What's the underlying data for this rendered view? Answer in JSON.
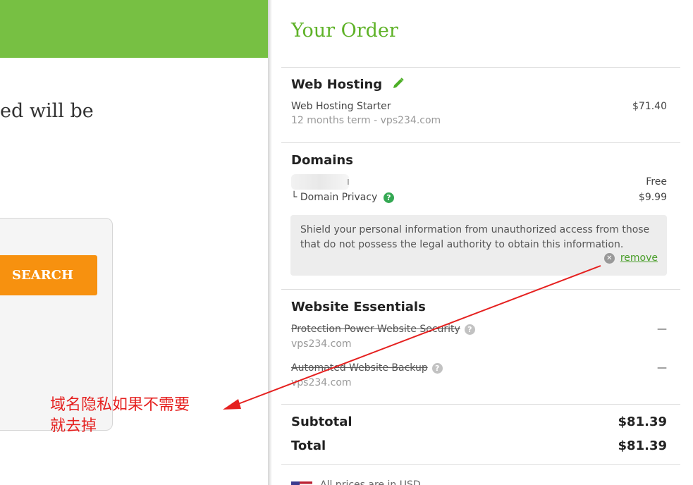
{
  "left": {
    "intro_text": "ed will be",
    "search_button": "SEARCH",
    "annotation_line1": "域名隐私如果不需要",
    "annotation_line2": "就去掉"
  },
  "order": {
    "title": "Your Order",
    "hosting": {
      "title": "Web Hosting",
      "product": "Web Hosting Starter",
      "term": "12 months term - vps234.com",
      "price": "$71.40"
    },
    "domains": {
      "title": "Domains",
      "domain_suffix": "ı",
      "domain_price": "Free",
      "privacy_label": "└ Domain Privacy",
      "privacy_price": "$9.99",
      "note": "Shield your personal information from unauthorized access from those that do not possess the legal authority to obtain this information.",
      "remove_label": "remove"
    },
    "essentials": {
      "title": "Website Essentials",
      "items": [
        {
          "name": "Protection Power Website Security",
          "domain": "vps234.com",
          "price": "—"
        },
        {
          "name": "Automated Website Backup",
          "domain": "vps234.com",
          "price": "—"
        }
      ]
    },
    "subtotal_label": "Subtotal",
    "subtotal_value": "$81.39",
    "total_label": "Total",
    "total_value": "$81.39",
    "currency_text": "All prices are in USD"
  },
  "colors": {
    "brand_green": "#77c043",
    "title_green": "#5eb227",
    "search_orange": "#f7910f",
    "annotation_red": "#e5201f"
  }
}
